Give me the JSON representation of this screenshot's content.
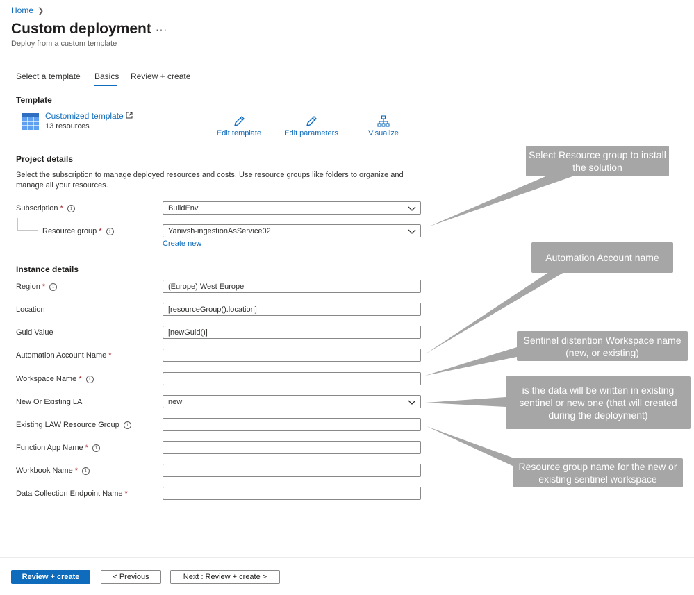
{
  "breadcrumb": {
    "home": "Home"
  },
  "header": {
    "title": "Custom deployment",
    "subtitle": "Deploy from a custom template",
    "more": "···"
  },
  "tabs": [
    {
      "label": "Select a template"
    },
    {
      "label": "Basics"
    },
    {
      "label": "Review + create"
    }
  ],
  "template": {
    "section_title": "Template",
    "name": "Customized template",
    "resources": "13 resources",
    "actions": {
      "edit_template": "Edit template",
      "edit_parameters": "Edit parameters",
      "visualize": "Visualize"
    }
  },
  "project": {
    "section_title": "Project details",
    "description": "Select the subscription to manage deployed resources and costs. Use resource groups like folders to organize and manage all your resources.",
    "subscription": {
      "label": "Subscription",
      "value": "BuildEnv"
    },
    "resource_group": {
      "label": "Resource group",
      "value": "Yanivsh-ingestionAsService02"
    },
    "create_new": "Create new"
  },
  "instance": {
    "section_title": "Instance details",
    "fields": [
      {
        "label": "Region",
        "value": "(Europe) West Europe"
      },
      {
        "label": "Location",
        "value": "[resourceGroup().location]"
      },
      {
        "label": "Guid Value",
        "value": "[newGuid()]"
      },
      {
        "label": "Automation Account Name",
        "value": ""
      },
      {
        "label": "Workspace Name",
        "value": ""
      },
      {
        "label": "New Or Existing LA",
        "value": "new"
      },
      {
        "label": "Existing LAW Resource Group",
        "value": ""
      },
      {
        "label": "Function App Name",
        "value": ""
      },
      {
        "label": "Workbook Name",
        "value": ""
      },
      {
        "label": "Data Collection Endpoint Name",
        "value": ""
      }
    ]
  },
  "footer": {
    "review_create": "Review + create",
    "previous": "< Previous",
    "next": "Next : Review + create >"
  },
  "callouts": {
    "resource_group": "Select Resource group to install the solution",
    "automation": "Automation Account name",
    "workspace": "Sentinel distention Workspace name (new, or existing)",
    "new_or_existing": "is the data will be written in existing sentinel or new one (that will created during the deployment)",
    "law_rg": "Resource group name for the new or existing sentinel workspace"
  },
  "colors": {
    "accent": "#0f6cbd",
    "required": "#a4262c",
    "callout": "#a6a6a6"
  }
}
